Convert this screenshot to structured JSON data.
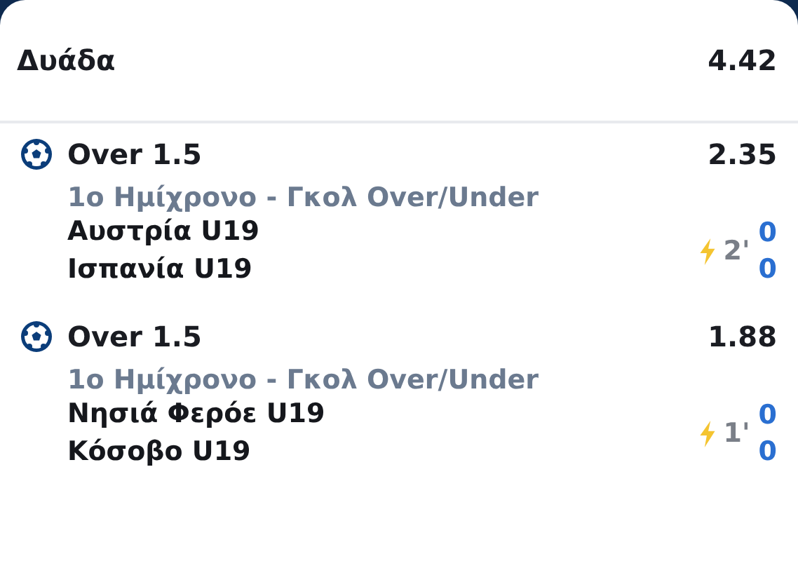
{
  "header": {
    "title": "Δυάδα",
    "odds": "4.42"
  },
  "selections": [
    {
      "pick": "Over 1.5",
      "odds": "2.35",
      "market": "1ο Ημίχρονο - Γκολ Over/Under",
      "home": "Αυστρία U19",
      "away": "Ισπανία U19",
      "minute": "2'",
      "home_score": "0",
      "away_score": "0"
    },
    {
      "pick": "Over 1.5",
      "odds": "1.88",
      "market": "1ο Ημίχρονο - Γκολ Over/Under",
      "home": "Νησιά Φερόε U19",
      "away": "Κόσοβο U19",
      "minute": "1'",
      "home_score": "0",
      "away_score": "0"
    }
  ]
}
